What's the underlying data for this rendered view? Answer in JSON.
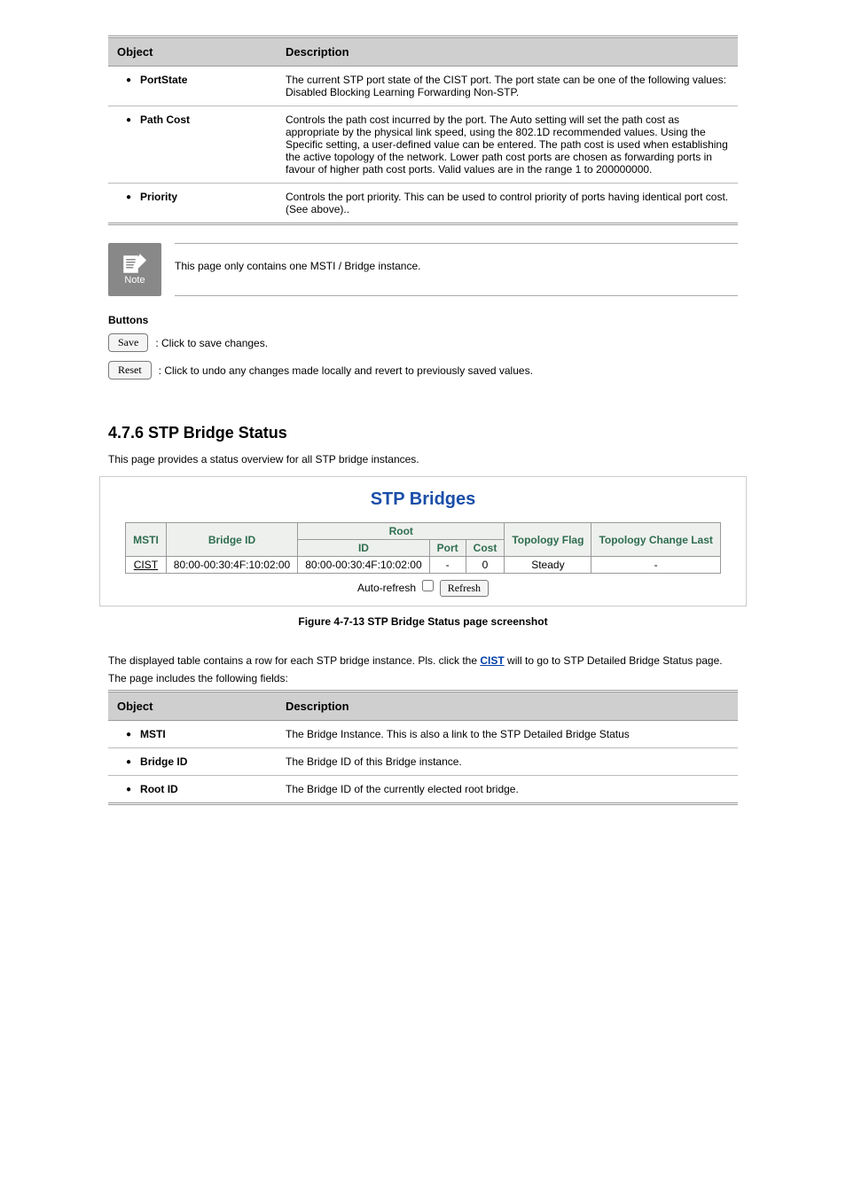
{
  "table1": {
    "headers": [
      "Object",
      "Description"
    ],
    "rows": [
      {
        "label": "PortState",
        "desc": "The current STP port state of the CIST port. The port state can be one of the following values: Disabled Blocking Learning Forwarding Non-STP."
      },
      {
        "label": "Path Cost",
        "desc": "Controls the path cost incurred by the port. The Auto setting will set the path cost as appropriate by the physical link speed, using the 802.1D recommended values. Using the Specific setting, a user-defined value can be entered. The path cost is used when establishing the active topology of the network. Lower path cost ports are chosen as forwarding ports in favour of higher path cost ports. Valid values are in the range 1 to 200000000."
      },
      {
        "label": "Priority",
        "desc": "Controls the port priority. This can be used to control priority of ports having identical port cost. (See above).."
      }
    ]
  },
  "note": {
    "label": "Note",
    "text": "This page only contains one MSTI / Bridge instance."
  },
  "buttons": {
    "heading": "Buttons",
    "save_label": "Save",
    "save_desc": ": Click to save changes.",
    "reset_label": "Reset",
    "reset_desc": ": Click to undo any changes made locally and revert to previously saved values."
  },
  "section": {
    "heading": "4.7.6 STP Bridge Status",
    "text": "This page provides a status overview for all STP bridge instances."
  },
  "figure": {
    "title": "STP Bridges",
    "headers": {
      "msti": "MSTI",
      "bridge_id": "Bridge ID",
      "root": "Root",
      "root_id": "ID",
      "root_port": "Port",
      "root_cost": "Cost",
      "topo_flag": "Topology Flag",
      "topo_change": "Topology Change Last"
    },
    "row": {
      "msti": "CIST",
      "bridge_id": "80:00-00:30:4F:10:02:00",
      "root_id": "80:00-00:30:4F:10:02:00",
      "root_port": "-",
      "root_cost": "0",
      "topo_flag": "Steady",
      "topo_change": "-"
    },
    "auto_refresh_label": "Auto-refresh",
    "refresh_label": "Refresh",
    "caption": "Figure 4-7-13 STP Bridge Status page screenshot"
  },
  "page_desc": {
    "line1_part1": "The displayed table contains a row for each STP bridge instance. Pls. click the ",
    "line1_link": "CIST",
    "line1_part2": " will to go to STP Detailed Bridge Status page.",
    "line2": "The page includes the following fields:"
  },
  "table2": {
    "headers": [
      "Object",
      "Description"
    ],
    "rows": [
      {
        "label": "MSTI",
        "desc": "The Bridge Instance. This is also a link to the STP Detailed Bridge Status"
      },
      {
        "label": "Bridge ID",
        "desc": "The Bridge ID of this Bridge instance."
      },
      {
        "label": "Root ID",
        "desc": "The Bridge ID of the currently elected root bridge."
      }
    ]
  }
}
